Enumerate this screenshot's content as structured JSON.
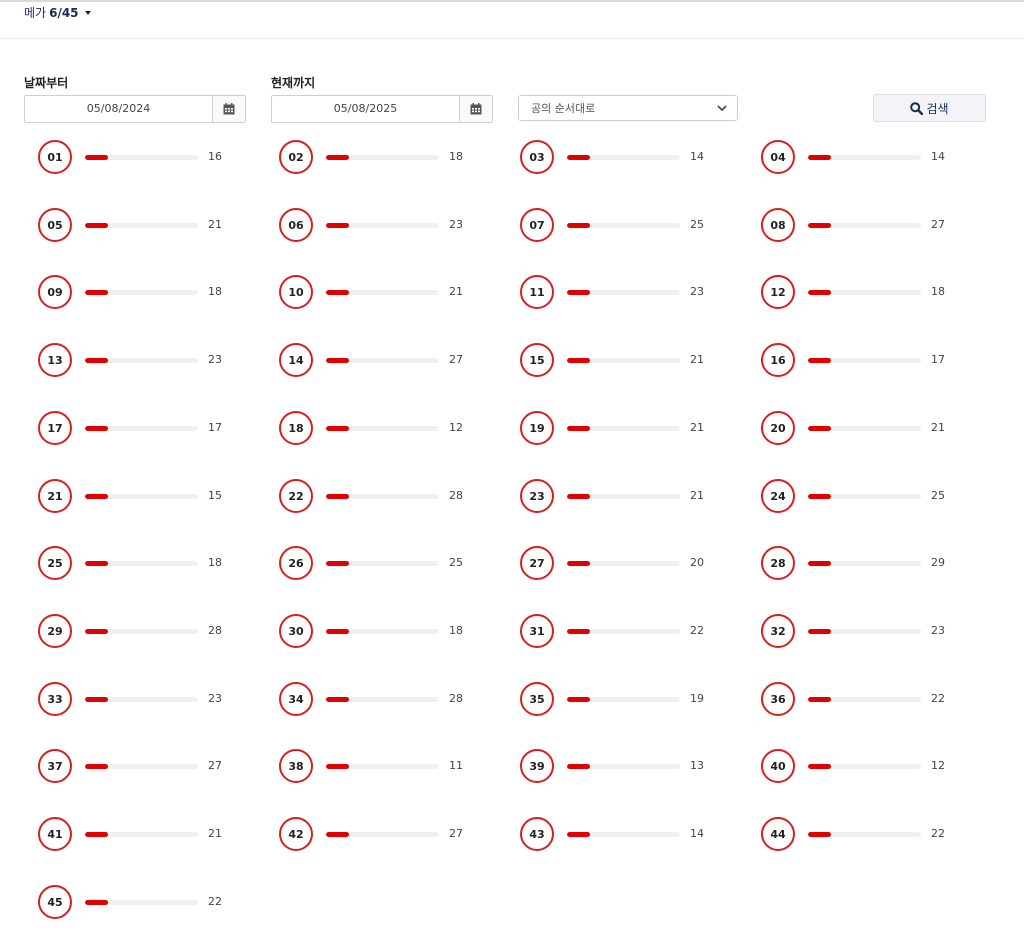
{
  "header": {
    "game_name": "메가",
    "game_ratio": "6/45"
  },
  "filters": {
    "from_label": "날짜부터",
    "from_date": "05/08/2024",
    "to_label": "현재까지",
    "to_date": "05/08/2025",
    "sort_value": "공의 순서대로",
    "search_label": "검색"
  },
  "colors": {
    "ball_border": "#d6201f",
    "bar_fill": "#e00000",
    "bar_track": "#f0f0f0",
    "accent_text": "#1a2a55"
  },
  "icons": {
    "calendar": "calendar-icon",
    "search": "search-icon",
    "chevron": "chevron-down-icon",
    "caret": "caret-down-icon"
  },
  "balls": [
    {
      "number": "01",
      "count": "16",
      "fill_pct": 20
    },
    {
      "number": "02",
      "count": "18",
      "fill_pct": 20
    },
    {
      "number": "03",
      "count": "14",
      "fill_pct": 20
    },
    {
      "number": "04",
      "count": "14",
      "fill_pct": 20
    },
    {
      "number": "05",
      "count": "21",
      "fill_pct": 20
    },
    {
      "number": "06",
      "count": "23",
      "fill_pct": 20
    },
    {
      "number": "07",
      "count": "25",
      "fill_pct": 20
    },
    {
      "number": "08",
      "count": "27",
      "fill_pct": 20
    },
    {
      "number": "09",
      "count": "18",
      "fill_pct": 20
    },
    {
      "number": "10",
      "count": "21",
      "fill_pct": 20
    },
    {
      "number": "11",
      "count": "23",
      "fill_pct": 20
    },
    {
      "number": "12",
      "count": "18",
      "fill_pct": 20
    },
    {
      "number": "13",
      "count": "23",
      "fill_pct": 20
    },
    {
      "number": "14",
      "count": "27",
      "fill_pct": 20
    },
    {
      "number": "15",
      "count": "21",
      "fill_pct": 20
    },
    {
      "number": "16",
      "count": "17",
      "fill_pct": 20
    },
    {
      "number": "17",
      "count": "17",
      "fill_pct": 20
    },
    {
      "number": "18",
      "count": "12",
      "fill_pct": 20
    },
    {
      "number": "19",
      "count": "21",
      "fill_pct": 20
    },
    {
      "number": "20",
      "count": "21",
      "fill_pct": 20
    },
    {
      "number": "21",
      "count": "15",
      "fill_pct": 20
    },
    {
      "number": "22",
      "count": "28",
      "fill_pct": 20
    },
    {
      "number": "23",
      "count": "21",
      "fill_pct": 20
    },
    {
      "number": "24",
      "count": "25",
      "fill_pct": 20
    },
    {
      "number": "25",
      "count": "18",
      "fill_pct": 20
    },
    {
      "number": "26",
      "count": "25",
      "fill_pct": 20
    },
    {
      "number": "27",
      "count": "20",
      "fill_pct": 20
    },
    {
      "number": "28",
      "count": "29",
      "fill_pct": 20
    },
    {
      "number": "29",
      "count": "28",
      "fill_pct": 20
    },
    {
      "number": "30",
      "count": "18",
      "fill_pct": 20
    },
    {
      "number": "31",
      "count": "22",
      "fill_pct": 20
    },
    {
      "number": "32",
      "count": "23",
      "fill_pct": 20
    },
    {
      "number": "33",
      "count": "23",
      "fill_pct": 20
    },
    {
      "number": "34",
      "count": "28",
      "fill_pct": 20
    },
    {
      "number": "35",
      "count": "19",
      "fill_pct": 20
    },
    {
      "number": "36",
      "count": "22",
      "fill_pct": 20
    },
    {
      "number": "37",
      "count": "27",
      "fill_pct": 20
    },
    {
      "number": "38",
      "count": "11",
      "fill_pct": 20
    },
    {
      "number": "39",
      "count": "13",
      "fill_pct": 20
    },
    {
      "number": "40",
      "count": "12",
      "fill_pct": 20
    },
    {
      "number": "41",
      "count": "21",
      "fill_pct": 20
    },
    {
      "number": "42",
      "count": "27",
      "fill_pct": 20
    },
    {
      "number": "43",
      "count": "14",
      "fill_pct": 20
    },
    {
      "number": "44",
      "count": "22",
      "fill_pct": 20
    },
    {
      "number": "45",
      "count": "22",
      "fill_pct": 20
    }
  ]
}
